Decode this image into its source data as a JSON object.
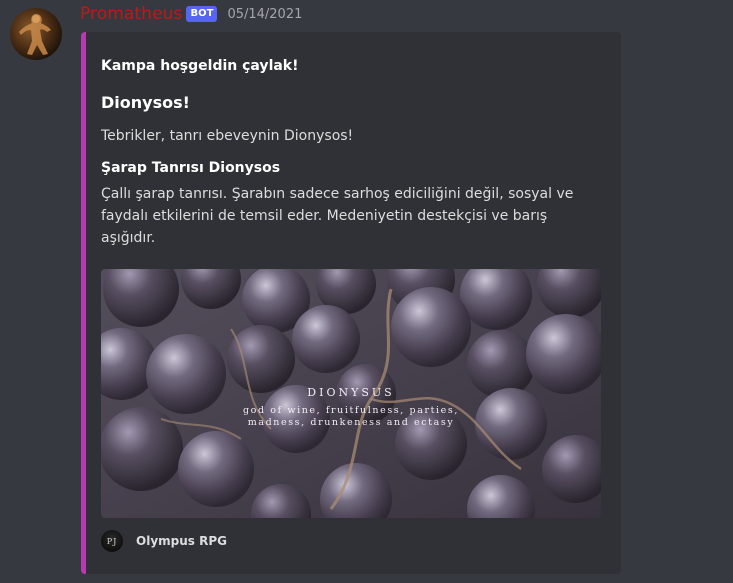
{
  "message": {
    "username": "Promatheus",
    "bot_tag": "BOT",
    "timestamp": "05/14/2021",
    "avatar_icon": "bronze-statue-avatar"
  },
  "embed": {
    "accent_color": "#b73ab1",
    "author": "Kampa hoşgeldin çaylak!",
    "title": "Dionysos!",
    "description": "Tebrikler, tanrı ebeveynin Dionysos!",
    "field": {
      "name": "Şarap Tanrısı Dionysos",
      "value": "Çallı şarap tanrısı. Şarabın sadece sarhoş ediciliğini değil, sosyal ve faydalı etkilerini de temsil eder. Medeniyetin destekçisi ve barış aşığıdır."
    },
    "image": {
      "subject": "grapes",
      "caption_title": "DIONYSUS",
      "caption_line1": "god of wine, fruitfulness, parties,",
      "caption_line2": "madness, drunkeness and ectasy"
    },
    "footer": {
      "icon": "olympus-rpg-icon",
      "icon_text": "PJ",
      "text": "Olympus RPG"
    }
  }
}
